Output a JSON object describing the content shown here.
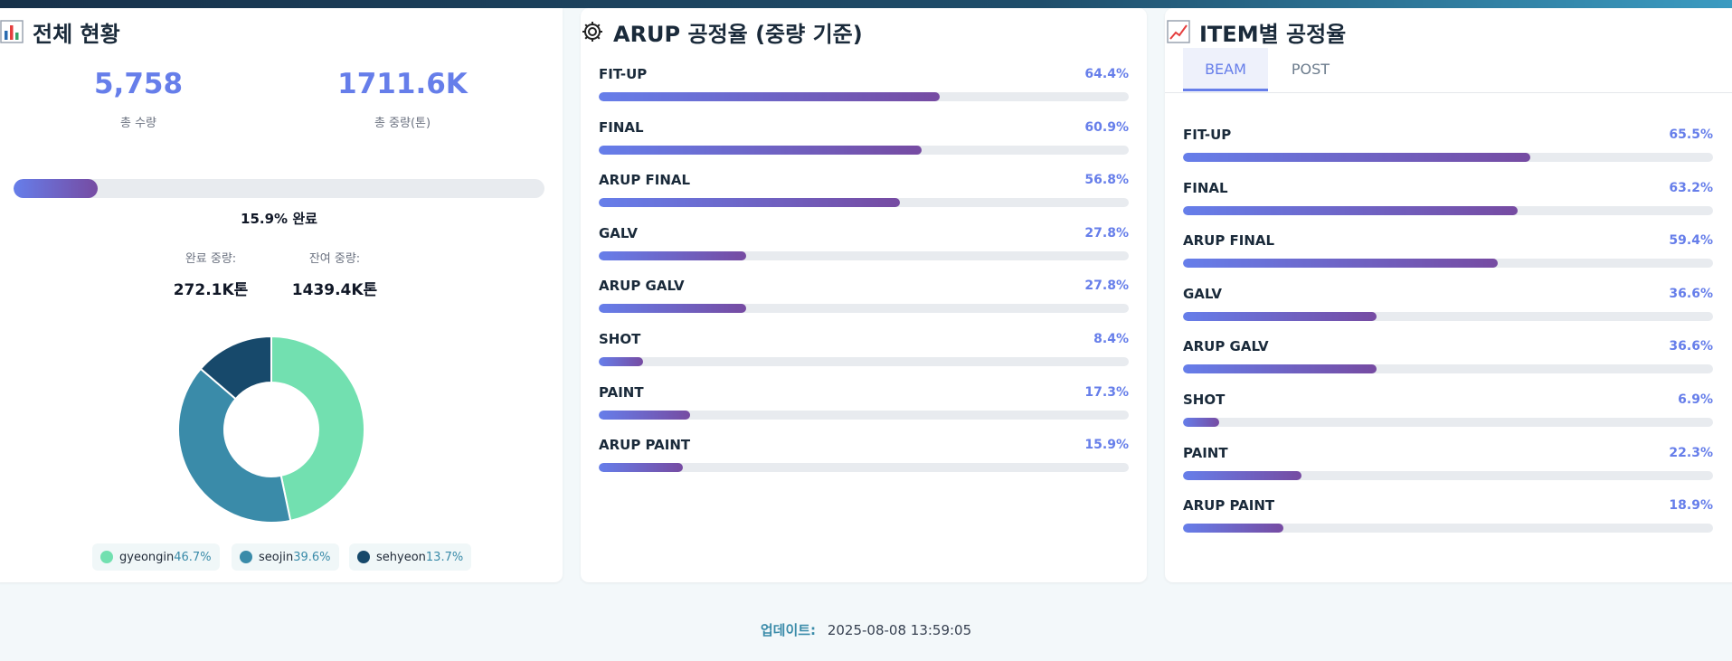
{
  "overview": {
    "title": "전체 현황",
    "icon": "bar-chart-icon",
    "total_qty": "5,758",
    "total_qty_label": "총 수량",
    "total_weight": "1711.6K",
    "total_weight_label": "총 중량(톤)",
    "progress": 15.9,
    "progress_text": "15.9%",
    "progress_suffix": "완료",
    "done_weight_label": "완료 중량:",
    "done_weight": "272.1K톤",
    "remain_weight_label": "잔여 중량:",
    "remain_weight": "1439.4K톤",
    "donut": [
      {
        "name": "gyeongin",
        "pct": 46.7,
        "pct_text": "46.7%",
        "color": "#72e0b0"
      },
      {
        "name": "seojin",
        "pct": 39.6,
        "pct_text": "39.6%",
        "color": "#3a8ba9"
      },
      {
        "name": "sehyeon",
        "pct": 13.7,
        "pct_text": "13.7%",
        "color": "#17496b"
      }
    ]
  },
  "arup": {
    "title": "ARUP 공정율 (중량 기준)",
    "icon": "gear-icon",
    "rows": [
      {
        "label": "FIT-UP",
        "pct": 64.4,
        "pct_text": "64.4%"
      },
      {
        "label": "FINAL",
        "pct": 60.9,
        "pct_text": "60.9%"
      },
      {
        "label": "ARUP FINAL",
        "pct": 56.8,
        "pct_text": "56.8%"
      },
      {
        "label": "GALV",
        "pct": 27.8,
        "pct_text": "27.8%"
      },
      {
        "label": "ARUP GALV",
        "pct": 27.8,
        "pct_text": "27.8%"
      },
      {
        "label": "SHOT",
        "pct": 8.4,
        "pct_text": "8.4%"
      },
      {
        "label": "PAINT",
        "pct": 17.3,
        "pct_text": "17.3%"
      },
      {
        "label": "ARUP PAINT",
        "pct": 15.9,
        "pct_text": "15.9%"
      }
    ]
  },
  "item": {
    "title": "ITEM별 공정율",
    "icon": "line-chart-icon",
    "tabs": [
      {
        "label": "BEAM",
        "active": true
      },
      {
        "label": "POST",
        "active": false
      }
    ],
    "rows": [
      {
        "label": "FIT-UP",
        "pct": 65.5,
        "pct_text": "65.5%"
      },
      {
        "label": "FINAL",
        "pct": 63.2,
        "pct_text": "63.2%"
      },
      {
        "label": "ARUP FINAL",
        "pct": 59.4,
        "pct_text": "59.4%"
      },
      {
        "label": "GALV",
        "pct": 36.6,
        "pct_text": "36.6%"
      },
      {
        "label": "ARUP GALV",
        "pct": 36.6,
        "pct_text": "36.6%"
      },
      {
        "label": "SHOT",
        "pct": 6.9,
        "pct_text": "6.9%"
      },
      {
        "label": "PAINT",
        "pct": 22.3,
        "pct_text": "22.3%"
      },
      {
        "label": "ARUP PAINT",
        "pct": 18.9,
        "pct_text": "18.9%"
      }
    ]
  },
  "footer": {
    "label": "업데이트:",
    "timestamp": "2025-08-08 13:59:05"
  },
  "colors": {
    "accent": "#667eea",
    "accent_end": "#764ba2"
  }
}
